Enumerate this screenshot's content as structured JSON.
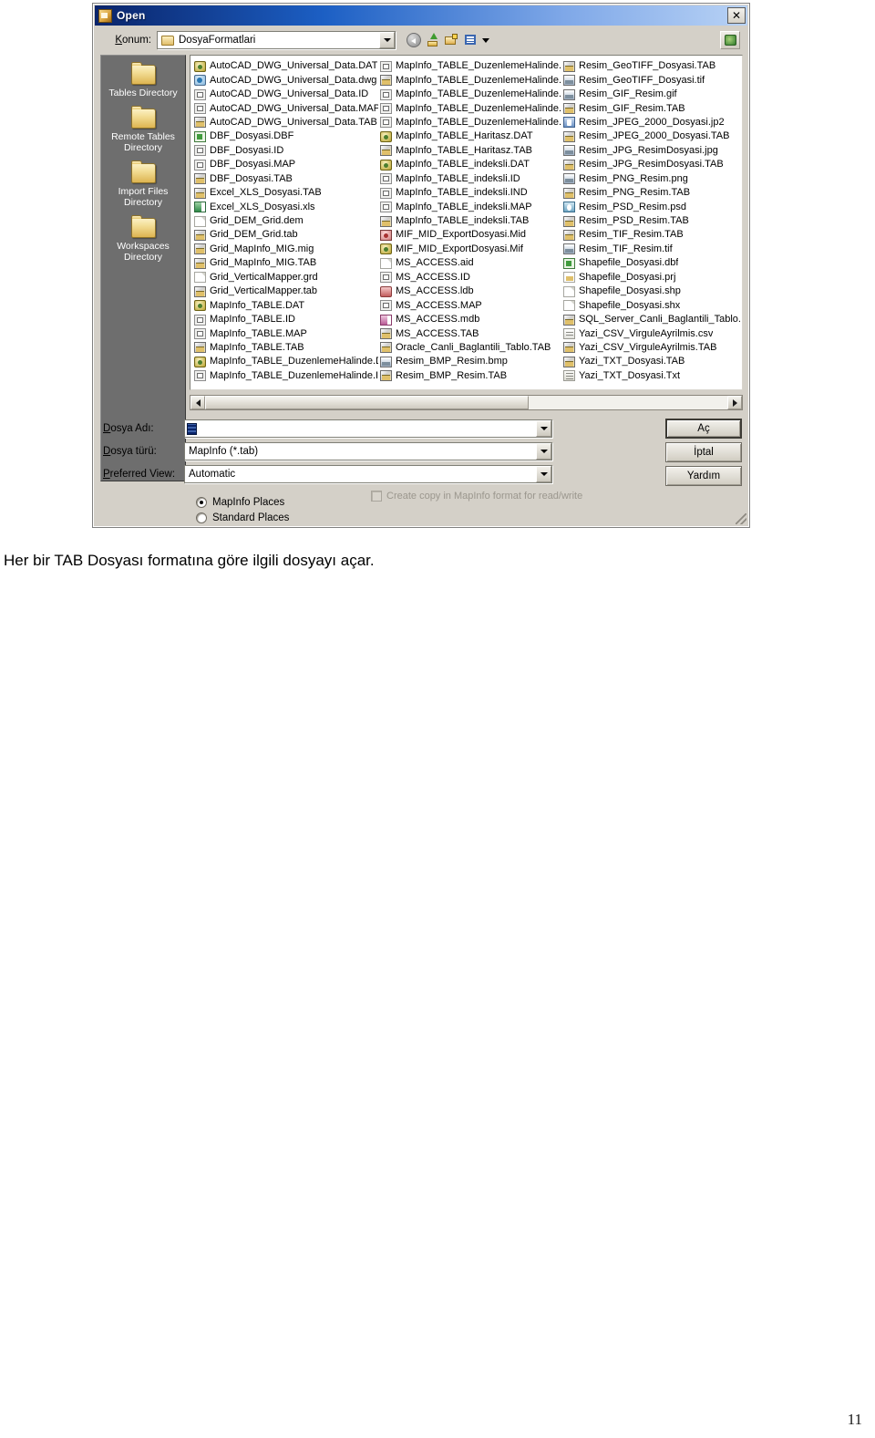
{
  "dialog": {
    "title": "Open",
    "title_icon": "open-folder-icon",
    "close_label": "✕",
    "location": {
      "label_prefix": "K",
      "label_rest": "onum:",
      "value": "DosyaFormatlari",
      "folder_icon": "folder-icon",
      "dropdown_icon": "chevron-down-icon"
    },
    "toolbar": [
      {
        "name": "back-icon",
        "title": "Back"
      },
      {
        "name": "up-one-level-icon",
        "title": "Up One Level"
      },
      {
        "name": "create-new-folder-icon",
        "title": "Create New Folder"
      },
      {
        "name": "views-icon",
        "title": "Views"
      }
    ],
    "toolbar_right": {
      "name": "mapinfo-tool-icon",
      "title": "MapInfo"
    },
    "places": [
      {
        "label": "Tables Directory",
        "icon": "folder-icon"
      },
      {
        "label": "Remote Tables\nDirectory",
        "line1": "Remote Tables",
        "line2": "Directory",
        "icon": "folder-icon"
      },
      {
        "label": "Import Files\nDirectory",
        "line1": "Import Files",
        "line2": "Directory",
        "icon": "folder-icon"
      },
      {
        "label": "Workspaces\nDirectory",
        "line1": "Workspaces",
        "line2": "Directory",
        "icon": "folder-icon"
      }
    ],
    "files": {
      "column1": [
        {
          "name": "AutoCAD_DWG_Universal_Data.DAT",
          "icon": "dat-file-icon",
          "ic": "ic-dat"
        },
        {
          "name": "AutoCAD_DWG_Universal_Data.dwg",
          "icon": "dwg-file-icon",
          "ic": "ic-dwg"
        },
        {
          "name": "AutoCAD_DWG_Universal_Data.ID",
          "icon": "id-file-icon",
          "ic": "ic-grid"
        },
        {
          "name": "AutoCAD_DWG_Universal_Data.MAP",
          "icon": "map-file-icon",
          "ic": "ic-grid"
        },
        {
          "name": "AutoCAD_DWG_Universal_Data.TAB",
          "icon": "tab-file-icon",
          "ic": "ic-tab"
        },
        {
          "name": "DBF_Dosyasi.DBF",
          "icon": "dbf-file-icon",
          "ic": "ic-dbf"
        },
        {
          "name": "DBF_Dosyasi.ID",
          "icon": "id-file-icon",
          "ic": "ic-grid"
        },
        {
          "name": "DBF_Dosyasi.MAP",
          "icon": "map-file-icon",
          "ic": "ic-grid"
        },
        {
          "name": "DBF_Dosyasi.TAB",
          "icon": "tab-file-icon",
          "ic": "ic-tab"
        },
        {
          "name": "Excel_XLS_Dosyasi.TAB",
          "icon": "tab-file-icon",
          "ic": "ic-tab"
        },
        {
          "name": "Excel_XLS_Dosyasi.xls",
          "icon": "xls-file-icon",
          "ic": "ic-xls"
        },
        {
          "name": "Grid_DEM_Grid.dem",
          "icon": "generic-file-icon",
          "ic": "ic-plain"
        },
        {
          "name": "Grid_DEM_Grid.tab",
          "icon": "tab-file-icon",
          "ic": "ic-tab"
        },
        {
          "name": "Grid_MapInfo_MIG.mig",
          "icon": "tab-file-icon",
          "ic": "ic-tab"
        },
        {
          "name": "Grid_MapInfo_MIG.TAB",
          "icon": "tab-file-icon",
          "ic": "ic-tab"
        },
        {
          "name": "Grid_VerticalMapper.grd",
          "icon": "generic-file-icon",
          "ic": "ic-plain"
        },
        {
          "name": "Grid_VerticalMapper.tab",
          "icon": "tab-file-icon",
          "ic": "ic-tab"
        },
        {
          "name": "MapInfo_TABLE.DAT",
          "icon": "dat-file-icon",
          "ic": "ic-dat"
        },
        {
          "name": "MapInfo_TABLE.ID",
          "icon": "id-file-icon",
          "ic": "ic-grid"
        },
        {
          "name": "MapInfo_TABLE.MAP",
          "icon": "map-file-icon",
          "ic": "ic-grid"
        },
        {
          "name": "MapInfo_TABLE.TAB",
          "icon": "tab-file-icon",
          "ic": "ic-tab"
        },
        {
          "name": "MapInfo_TABLE_DuzenlemeHalinde.DAT",
          "icon": "dat-file-icon",
          "ic": "ic-dat"
        },
        {
          "name": "MapInfo_TABLE_DuzenlemeHalinde.ID",
          "icon": "id-file-icon",
          "ic": "ic-grid"
        }
      ],
      "column2": [
        {
          "name": "MapInfo_TABLE_DuzenlemeHalinde.MAP",
          "icon": "map-file-icon",
          "ic": "ic-grid"
        },
        {
          "name": "MapInfo_TABLE_DuzenlemeHalinde.TAB",
          "icon": "tab-file-icon",
          "ic": "ic-tab"
        },
        {
          "name": "MapInfo_TABLE_DuzenlemeHalinde.TDA",
          "icon": "tda-file-icon",
          "ic": "ic-grid"
        },
        {
          "name": "MapInfo_TABLE_DuzenlemeHalinde.TIN",
          "icon": "tin-file-icon",
          "ic": "ic-grid"
        },
        {
          "name": "MapInfo_TABLE_DuzenlemeHalinde.TMA",
          "icon": "tma-file-icon",
          "ic": "ic-grid"
        },
        {
          "name": "MapInfo_TABLE_Haritasz.DAT",
          "icon": "dat-file-icon",
          "ic": "ic-dat"
        },
        {
          "name": "MapInfo_TABLE_Haritasz.TAB",
          "icon": "tab-file-icon",
          "ic": "ic-tab"
        },
        {
          "name": "MapInfo_TABLE_indeksli.DAT",
          "icon": "dat-file-icon",
          "ic": "ic-dat"
        },
        {
          "name": "MapInfo_TABLE_indeksli.ID",
          "icon": "id-file-icon",
          "ic": "ic-grid"
        },
        {
          "name": "MapInfo_TABLE_indeksli.IND",
          "icon": "ind-file-icon",
          "ic": "ic-grid"
        },
        {
          "name": "MapInfo_TABLE_indeksli.MAP",
          "icon": "map-file-icon",
          "ic": "ic-grid"
        },
        {
          "name": "MapInfo_TABLE_indeksli.TAB",
          "icon": "tab-file-icon",
          "ic": "ic-tab"
        },
        {
          "name": "MIF_MID_ExportDosyasi.Mid",
          "icon": "mid-file-icon",
          "ic": "ic-mid"
        },
        {
          "name": "MIF_MID_ExportDosyasi.Mif",
          "icon": "mif-file-icon",
          "ic": "ic-dat"
        },
        {
          "name": "MS_ACCESS.aid",
          "icon": "generic-file-icon",
          "ic": "ic-plain"
        },
        {
          "name": "MS_ACCESS.ID",
          "icon": "id-file-icon",
          "ic": "ic-grid"
        },
        {
          "name": "MS_ACCESS.ldb",
          "icon": "ldb-file-icon",
          "ic": "ic-ldb"
        },
        {
          "name": "MS_ACCESS.MAP",
          "icon": "map-file-icon",
          "ic": "ic-grid"
        },
        {
          "name": "MS_ACCESS.mdb",
          "icon": "mdb-file-icon",
          "ic": "ic-mdb"
        },
        {
          "name": "MS_ACCESS.TAB",
          "icon": "tab-file-icon",
          "ic": "ic-tab"
        },
        {
          "name": "Oracle_Canli_Baglantili_Tablo.TAB",
          "icon": "tab-file-icon",
          "ic": "ic-tab"
        },
        {
          "name": "Resim_BMP_Resim.bmp",
          "icon": "bmp-image-icon",
          "ic": "ic-img"
        },
        {
          "name": "Resim_BMP_Resim.TAB",
          "icon": "tab-file-icon",
          "ic": "ic-tab"
        }
      ],
      "column3": [
        {
          "name": "Resim_GeoTIFF_Dosyasi.TAB",
          "icon": "tab-file-icon",
          "ic": "ic-tab"
        },
        {
          "name": "Resim_GeoTIFF_Dosyasi.tif",
          "icon": "tif-image-icon",
          "ic": "ic-img"
        },
        {
          "name": "Resim_GIF_Resim.gif",
          "icon": "gif-image-icon",
          "ic": "ic-img"
        },
        {
          "name": "Resim_GIF_Resim.TAB",
          "icon": "tab-file-icon",
          "ic": "ic-tab"
        },
        {
          "name": "Resim_JPEG_2000_Dosyasi.jp2",
          "icon": "jp2-image-icon",
          "ic": "ic-jp2"
        },
        {
          "name": "Resim_JPEG_2000_Dosyasi.TAB",
          "icon": "tab-file-icon",
          "ic": "ic-tab"
        },
        {
          "name": "Resim_JPG_ResimDosyasi.jpg",
          "icon": "jpg-image-icon",
          "ic": "ic-img"
        },
        {
          "name": "Resim_JPG_ResimDosyasi.TAB",
          "icon": "tab-file-icon",
          "ic": "ic-tab"
        },
        {
          "name": "Resim_PNG_Resim.png",
          "icon": "png-image-icon",
          "ic": "ic-img"
        },
        {
          "name": "Resim_PNG_Resim.TAB",
          "icon": "tab-file-icon",
          "ic": "ic-tab"
        },
        {
          "name": "Resim_PSD_Resim.psd",
          "icon": "psd-image-icon",
          "ic": "ic-psd"
        },
        {
          "name": "Resim_PSD_Resim.TAB",
          "icon": "tab-file-icon",
          "ic": "ic-tab"
        },
        {
          "name": "Resim_TIF_Resim.TAB",
          "icon": "tab-file-icon",
          "ic": "ic-tab"
        },
        {
          "name": "Resim_TIF_Resim.tif",
          "icon": "tif-image-icon",
          "ic": "ic-img"
        },
        {
          "name": "Shapefile_Dosyasi.dbf",
          "icon": "dbf-file-icon",
          "ic": "ic-dbf"
        },
        {
          "name": "Shapefile_Dosyasi.prj",
          "icon": "prj-file-icon",
          "ic": "ic-prj"
        },
        {
          "name": "Shapefile_Dosyasi.shp",
          "icon": "generic-file-icon",
          "ic": "ic-plain"
        },
        {
          "name": "Shapefile_Dosyasi.shx",
          "icon": "generic-file-icon",
          "ic": "ic-plain"
        },
        {
          "name": "SQL_Server_Canli_Baglantili_Tablo.TAB",
          "icon": "tab-file-icon",
          "ic": "ic-tab"
        },
        {
          "name": "Yazi_CSV_VirguleAyrilmis.csv",
          "icon": "csv-file-icon",
          "ic": "ic-csv"
        },
        {
          "name": "Yazi_CSV_VirguleAyrilmis.TAB",
          "icon": "tab-file-icon",
          "ic": "ic-tab"
        },
        {
          "name": "Yazi_TXT_Dosyasi.TAB",
          "icon": "tab-file-icon",
          "ic": "ic-tab"
        },
        {
          "name": "Yazi_TXT_Dosyasi.Txt",
          "icon": "txt-file-icon",
          "ic": "ic-txt"
        }
      ]
    },
    "scrollbar": {
      "left_icon": "scroll-left-arrow-icon",
      "right_icon": "scroll-right-arrow-icon"
    },
    "fields": {
      "file_name": {
        "label_prefix": "D",
        "label_rest": "osya Adı:",
        "value": ""
      },
      "file_type": {
        "label_prefix": "D",
        "label_rest": "osya türü:",
        "value": "MapInfo (*.tab)"
      },
      "preferred_view": {
        "label_prefix": "P",
        "label_rest": "referred View:",
        "value": "Automatic"
      }
    },
    "checkbox": {
      "label": "Create copy in MapInfo format for read/write",
      "checked": false
    },
    "radios": [
      {
        "label": "MapInfo Places",
        "selected": true
      },
      {
        "label": "Standard Places",
        "selected": false
      }
    ],
    "buttons": [
      {
        "label": "Aç",
        "name": "open-button",
        "default": true
      },
      {
        "label": "İptal",
        "name": "cancel-button",
        "default": false
      },
      {
        "label": "Yardım",
        "name": "help-button",
        "default": false
      }
    ]
  },
  "document": {
    "caption": "Her bir TAB Dosyası formatına göre ilgili dosyayı açar.",
    "page_number": "11"
  }
}
